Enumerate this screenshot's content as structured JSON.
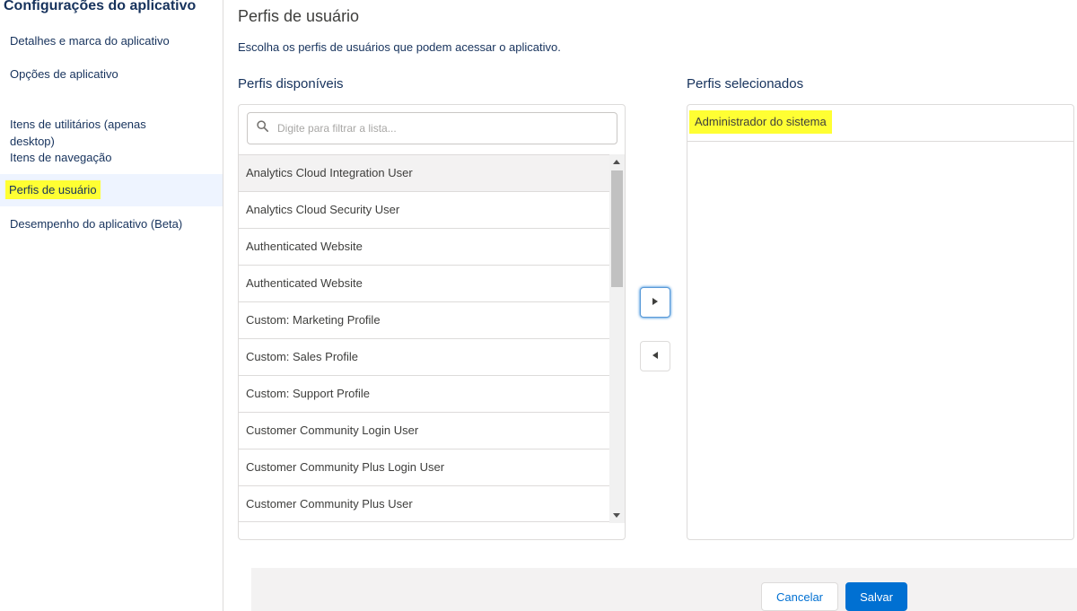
{
  "sidebar": {
    "title": "Configurações do aplicativo",
    "items": [
      {
        "label": "Detalhes e marca do aplicativo"
      },
      {
        "label": "Opções de aplicativo"
      },
      {
        "label": "Itens de utilitários (apenas\ndesktop)"
      },
      {
        "label": "Itens de navegação"
      },
      {
        "label": "Perfis de usuário",
        "active": true
      },
      {
        "label": "Desempenho do aplicativo (Beta)"
      }
    ]
  },
  "main": {
    "title": "Perfis de usuário",
    "description": "Escolha os perfis de usuários que podem acessar o aplicativo.",
    "available_label": "Perfis disponíveis",
    "selected_label": "Perfis selecionados",
    "search": {
      "placeholder": "Digite para filtrar a lista...",
      "value": ""
    },
    "available": [
      "Analytics Cloud Integration User",
      "Analytics Cloud Security User",
      "Authenticated Website",
      "Authenticated Website",
      "Custom: Marketing Profile",
      "Custom: Sales Profile",
      "Custom: Support Profile",
      "Customer Community Login User",
      "Customer Community Plus Login User",
      "Customer Community Plus User"
    ],
    "selected": [
      "Administrador do sistema"
    ]
  },
  "footer": {
    "cancel_label": "Cancelar",
    "save_label": "Salvar"
  },
  "icons": {
    "search": "search-icon",
    "move_right": "chevron-right-icon",
    "move_left": "chevron-left-icon"
  },
  "colors": {
    "brand": "#0070d2",
    "highlight": "#ffff33",
    "active_nav": "#eef4ff"
  }
}
